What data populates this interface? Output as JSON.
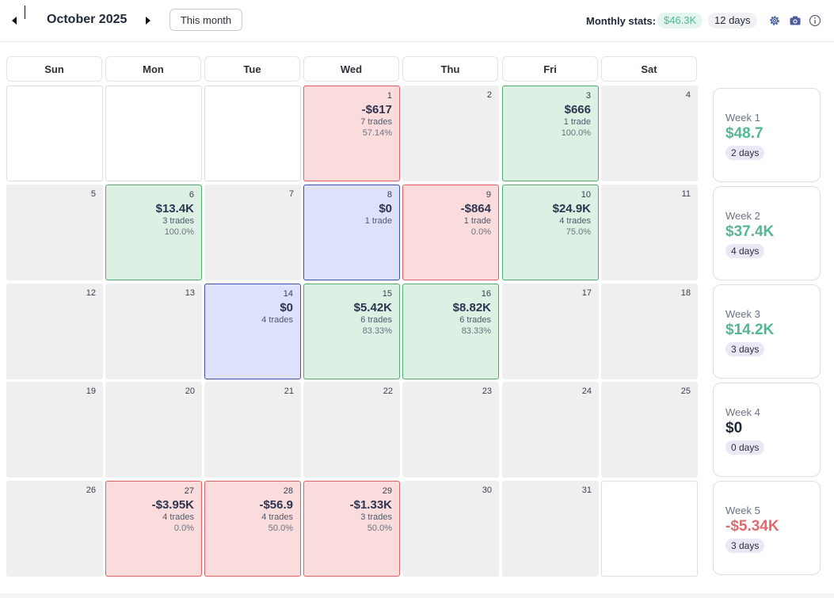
{
  "header": {
    "month_title": "October 2025",
    "this_month_label": "This month",
    "stats_label": "Monthly stats:",
    "stats_profit": "$46.3K",
    "stats_days": "12 days",
    "icons": [
      "caret-left-icon",
      "caret-right-icon",
      "gear-icon",
      "camera-icon",
      "info-icon"
    ]
  },
  "colors": {
    "profit": "#53b792",
    "loss": "#df6b6f",
    "neutral": "#1f2937",
    "win_bg": "#dcf0e3",
    "loss_bg": "#fbdcdd",
    "even_bg": "#dde1fb"
  },
  "weekdays": [
    "Sun",
    "Mon",
    "Tue",
    "Wed",
    "Thu",
    "Fri",
    "Sat"
  ],
  "days": [
    {
      "day": "",
      "status": "empty"
    },
    {
      "day": "",
      "status": "empty"
    },
    {
      "day": "",
      "status": "empty"
    },
    {
      "day": "1",
      "status": "loss",
      "pnl": "-$617",
      "trades": "7 trades",
      "rate": "57.14%"
    },
    {
      "day": "2",
      "status": "none"
    },
    {
      "day": "3",
      "status": "win",
      "pnl": "$666",
      "trades": "1 trade",
      "rate": "100.0%"
    },
    {
      "day": "4",
      "status": "none"
    },
    {
      "day": "5",
      "status": "none"
    },
    {
      "day": "6",
      "status": "win",
      "pnl": "$13.4K",
      "trades": "3 trades",
      "rate": "100.0%"
    },
    {
      "day": "7",
      "status": "none"
    },
    {
      "day": "8",
      "status": "even",
      "pnl": "$0",
      "trades": "1 trade"
    },
    {
      "day": "9",
      "status": "loss",
      "pnl": "-$864",
      "trades": "1 trade",
      "rate": "0.0%"
    },
    {
      "day": "10",
      "status": "win",
      "pnl": "$24.9K",
      "trades": "4 trades",
      "rate": "75.0%"
    },
    {
      "day": "11",
      "status": "none"
    },
    {
      "day": "12",
      "status": "none"
    },
    {
      "day": "13",
      "status": "none"
    },
    {
      "day": "14",
      "status": "even",
      "pnl": "$0",
      "trades": "4 trades"
    },
    {
      "day": "15",
      "status": "win",
      "pnl": "$5.42K",
      "trades": "6 trades",
      "rate": "83.33%"
    },
    {
      "day": "16",
      "status": "win",
      "pnl": "$8.82K",
      "trades": "6 trades",
      "rate": "83.33%"
    },
    {
      "day": "17",
      "status": "none"
    },
    {
      "day": "18",
      "status": "none"
    },
    {
      "day": "19",
      "status": "none"
    },
    {
      "day": "20",
      "status": "none"
    },
    {
      "day": "21",
      "status": "none"
    },
    {
      "day": "22",
      "status": "none"
    },
    {
      "day": "23",
      "status": "none"
    },
    {
      "day": "24",
      "status": "none"
    },
    {
      "day": "25",
      "status": "none"
    },
    {
      "day": "26",
      "status": "none"
    },
    {
      "day": "27",
      "status": "loss",
      "pnl": "-$3.95K",
      "trades": "4 trades",
      "rate": "0.0%"
    },
    {
      "day": "28",
      "status": "loss",
      "pnl": "-$56.9",
      "trades": "4 trades",
      "rate": "50.0%"
    },
    {
      "day": "29",
      "status": "loss",
      "pnl": "-$1.33K",
      "trades": "3 trades",
      "rate": "50.0%"
    },
    {
      "day": "30",
      "status": "none"
    },
    {
      "day": "31",
      "status": "none"
    },
    {
      "day": "",
      "status": "empty"
    }
  ],
  "weeks": [
    {
      "label": "Week 1",
      "value": "$48.7",
      "days": "2 days",
      "tone": "profit"
    },
    {
      "label": "Week 2",
      "value": "$37.4K",
      "days": "4 days",
      "tone": "profit"
    },
    {
      "label": "Week 3",
      "value": "$14.2K",
      "days": "3 days",
      "tone": "profit"
    },
    {
      "label": "Week 4",
      "value": "$0",
      "days": "0 days",
      "tone": "neutral"
    },
    {
      "label": "Week 5",
      "value": "-$5.34K",
      "days": "3 days",
      "tone": "loss"
    }
  ]
}
